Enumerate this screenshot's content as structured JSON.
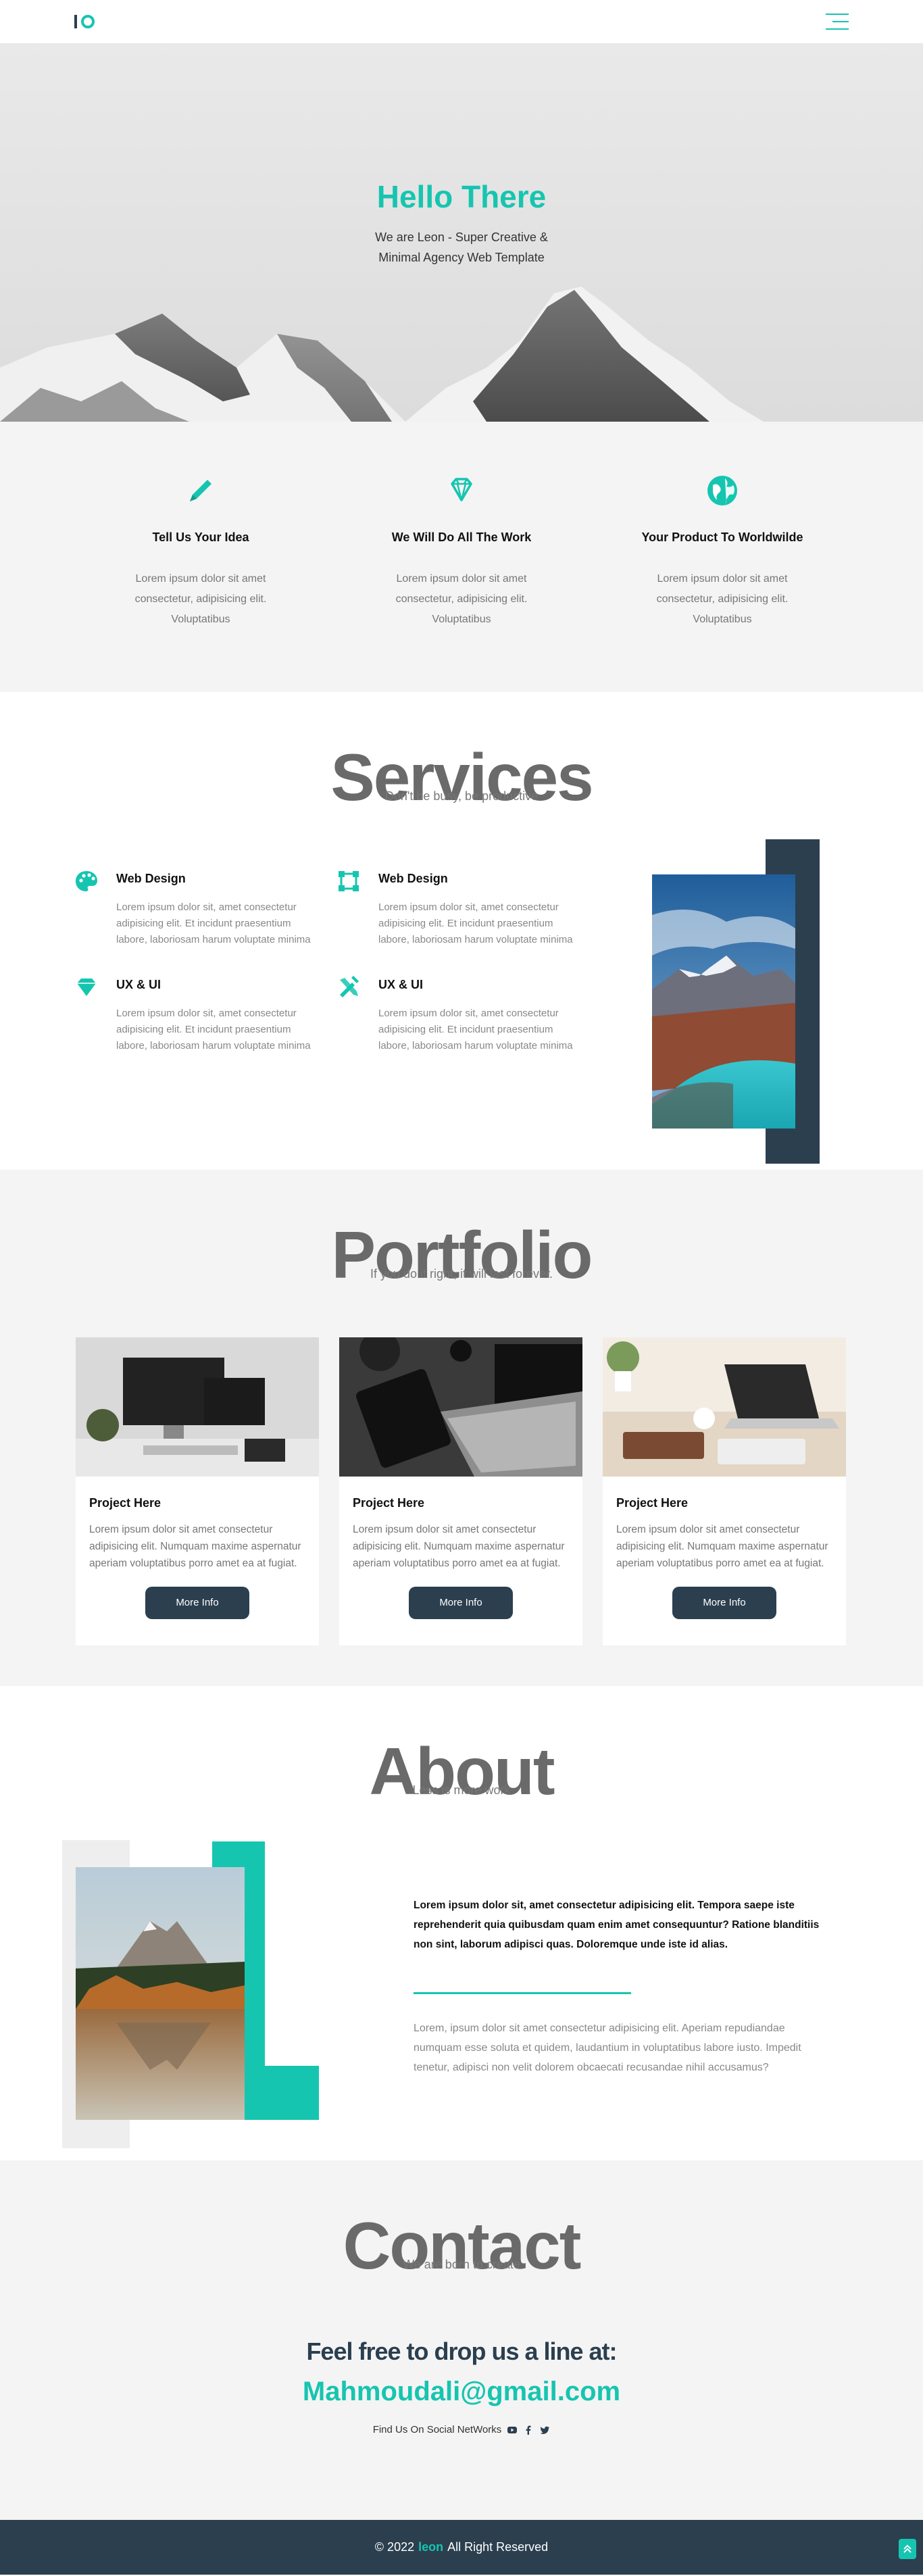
{
  "hero": {
    "title": "Hello There",
    "subtitle_line1": "We are Leon - Super Creative &",
    "subtitle_line2": "Minimal Agency Web Template"
  },
  "features": [
    {
      "icon": "pencil-icon",
      "title": "Tell Us Your Idea",
      "text": "Lorem ipsum dolor sit amet consectetur, adipisicing elit. Voluptatibus"
    },
    {
      "icon": "diamond-icon",
      "title": "We Will Do All The Work",
      "text": "Lorem ipsum dolor sit amet consectetur, adipisicing elit. Voluptatibus"
    },
    {
      "icon": "globe-icon",
      "title": "Your Product To Worldwilde",
      "text": "Lorem ipsum dolor sit amet consectetur, adipisicing elit. Voluptatibus"
    }
  ],
  "services": {
    "big_title": "Services",
    "subtitle": "Don't be busy, be productive",
    "items": [
      {
        "icon": "palette-icon",
        "title": "Web Design",
        "text": "Lorem ipsum dolor sit, amet consectetur adipisicing elit. Et incidunt praesentium labore, laboriosam harum voluptate minima"
      },
      {
        "icon": "vector-square-icon",
        "title": "Web Design",
        "text": "Lorem ipsum dolor sit, amet consectetur adipisicing elit. Et incidunt praesentium labore, laboriosam harum voluptate minima"
      },
      {
        "icon": "gem-icon",
        "title": "UX & UI",
        "text": "Lorem ipsum dolor sit, amet consectetur adipisicing elit. Et incidunt praesentium labore, laboriosam harum voluptate minima"
      },
      {
        "icon": "tools-icon",
        "title": "UX & UI",
        "text": "Lorem ipsum dolor sit, amet consectetur adipisicing elit. Et incidunt praesentium labore, laboriosam harum voluptate minima"
      }
    ]
  },
  "portfolio": {
    "big_title": "Portfolio",
    "subtitle": "If you do it right, it will last forever.",
    "cards": [
      {
        "title": "Project Here",
        "text": "Lorem ipsum dolor sit amet consectetur adipisicing elit. Numquam maxime aspernatur aperiam voluptatibus porro amet ea at fugiat.",
        "button": "More Info"
      },
      {
        "title": "Project Here",
        "text": "Lorem ipsum dolor sit amet consectetur adipisicing elit. Numquam maxime aspernatur aperiam voluptatibus porro amet ea at fugiat.",
        "button": "More Info"
      },
      {
        "title": "Project Here",
        "text": "Lorem ipsum dolor sit amet consectetur adipisicing elit. Numquam maxime aspernatur aperiam voluptatibus porro amet ea at fugiat.",
        "button": "More Info"
      }
    ]
  },
  "about": {
    "big_title": "About",
    "subtitle": "Less is more work",
    "bold_text": "Lorem ipsum dolor sit, amet consectetur adipisicing elit. Tempora saepe iste reprehenderit quia quibusdam quam enim amet consequuntur? Ratione blanditiis non sint, laborum adipisci quas. Doloremque unde iste id alias.",
    "text": "Lorem, ipsum dolor sit amet consectetur adipisicing elit. Aperiam repudiandae numquam esse soluta et quidem, laudantium in voluptatibus labore iusto. Impedit tenetur, adipisci non velit dolorem obcaecati recusandae nihil accusamus?"
  },
  "contact": {
    "big_title": "Contact",
    "subtitle": "We are born to create",
    "line": "Feel free to drop us a line at:",
    "email": "Mahmoudali@gmail.com",
    "social_label": "Find Us On Social NetWorks",
    "social_icons": [
      "youtube-icon",
      "facebook-icon",
      "twitter-icon"
    ]
  },
  "footer": {
    "prefix": "© 2022",
    "brand": "leon",
    "suffix": "All Right Reserved"
  },
  "colors": {
    "accent": "#16c5b0",
    "dark": "#2b3f4f"
  }
}
